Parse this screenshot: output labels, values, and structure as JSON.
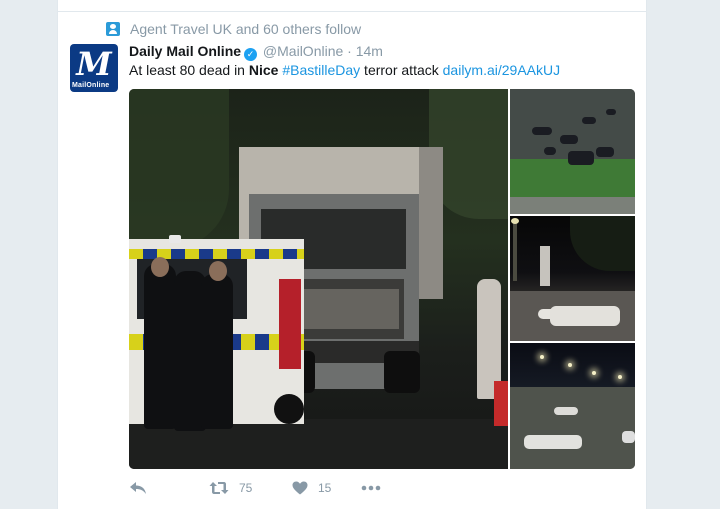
{
  "context": {
    "text": "Agent Travel UK and 60 others follow",
    "icon": "follow-person-icon"
  },
  "tweet": {
    "name": "Daily Mail Online",
    "handle": "@MailOnline",
    "separator": "·",
    "time": "14m",
    "text_before": "At least 80 dead in ",
    "text_keyword": "Nice",
    "text_space": " ",
    "hashtag": "#BastilleDay",
    "text_after": " terror attack ",
    "link": "dailym.ai/29AAkUJ",
    "avatar_letter": "M",
    "avatar_caption": "MailOnline"
  },
  "media": {
    "photos": [
      "main-photo",
      "thumbnail-1",
      "thumbnail-2",
      "thumbnail-3"
    ]
  },
  "actions": {
    "retweet_count": "75",
    "like_count": "15"
  },
  "colors": {
    "link": "#1b95e0",
    "muted": "#8899a6",
    "verified": "#1da1f2",
    "avatar_bg": "#0b3a84"
  }
}
